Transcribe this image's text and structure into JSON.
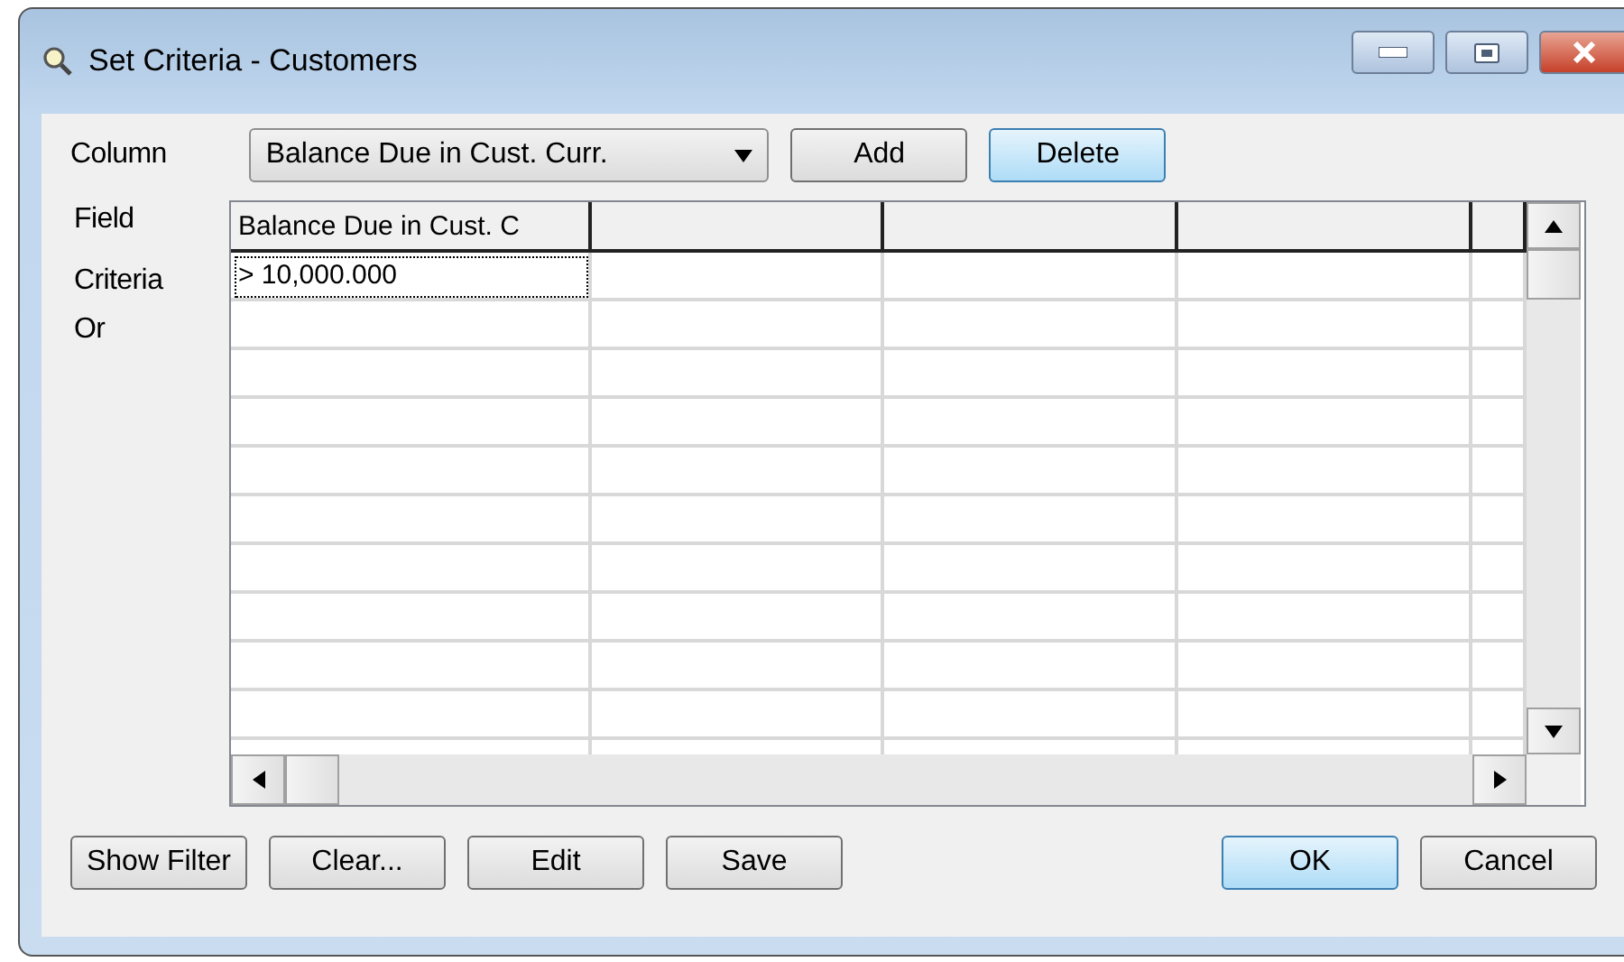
{
  "window": {
    "title": "Set Criteria - Customers"
  },
  "column_picker": {
    "label": "Column",
    "value": "Balance Due in Cust. Curr."
  },
  "top_buttons": [
    {
      "label": "Add",
      "focused": false
    },
    {
      "label": "Delete",
      "focused": true
    }
  ],
  "grid": {
    "row_labels": [
      "Field",
      "Criteria",
      "Or"
    ],
    "columns": [
      {
        "header": "Balance Due in Cust. C"
      }
    ],
    "criteria": [
      {
        "value": "> 10,000.000",
        "focused": true
      }
    ]
  },
  "left_buttons": [
    {
      "label": "Show Filter",
      "default": false
    },
    {
      "label": "Clear...",
      "default": false
    },
    {
      "label": "Edit",
      "default": false
    },
    {
      "label": "Save",
      "default": false
    }
  ],
  "right_buttons": [
    {
      "label": "OK",
      "default": true
    },
    {
      "label": "Cancel",
      "default": false
    }
  ]
}
